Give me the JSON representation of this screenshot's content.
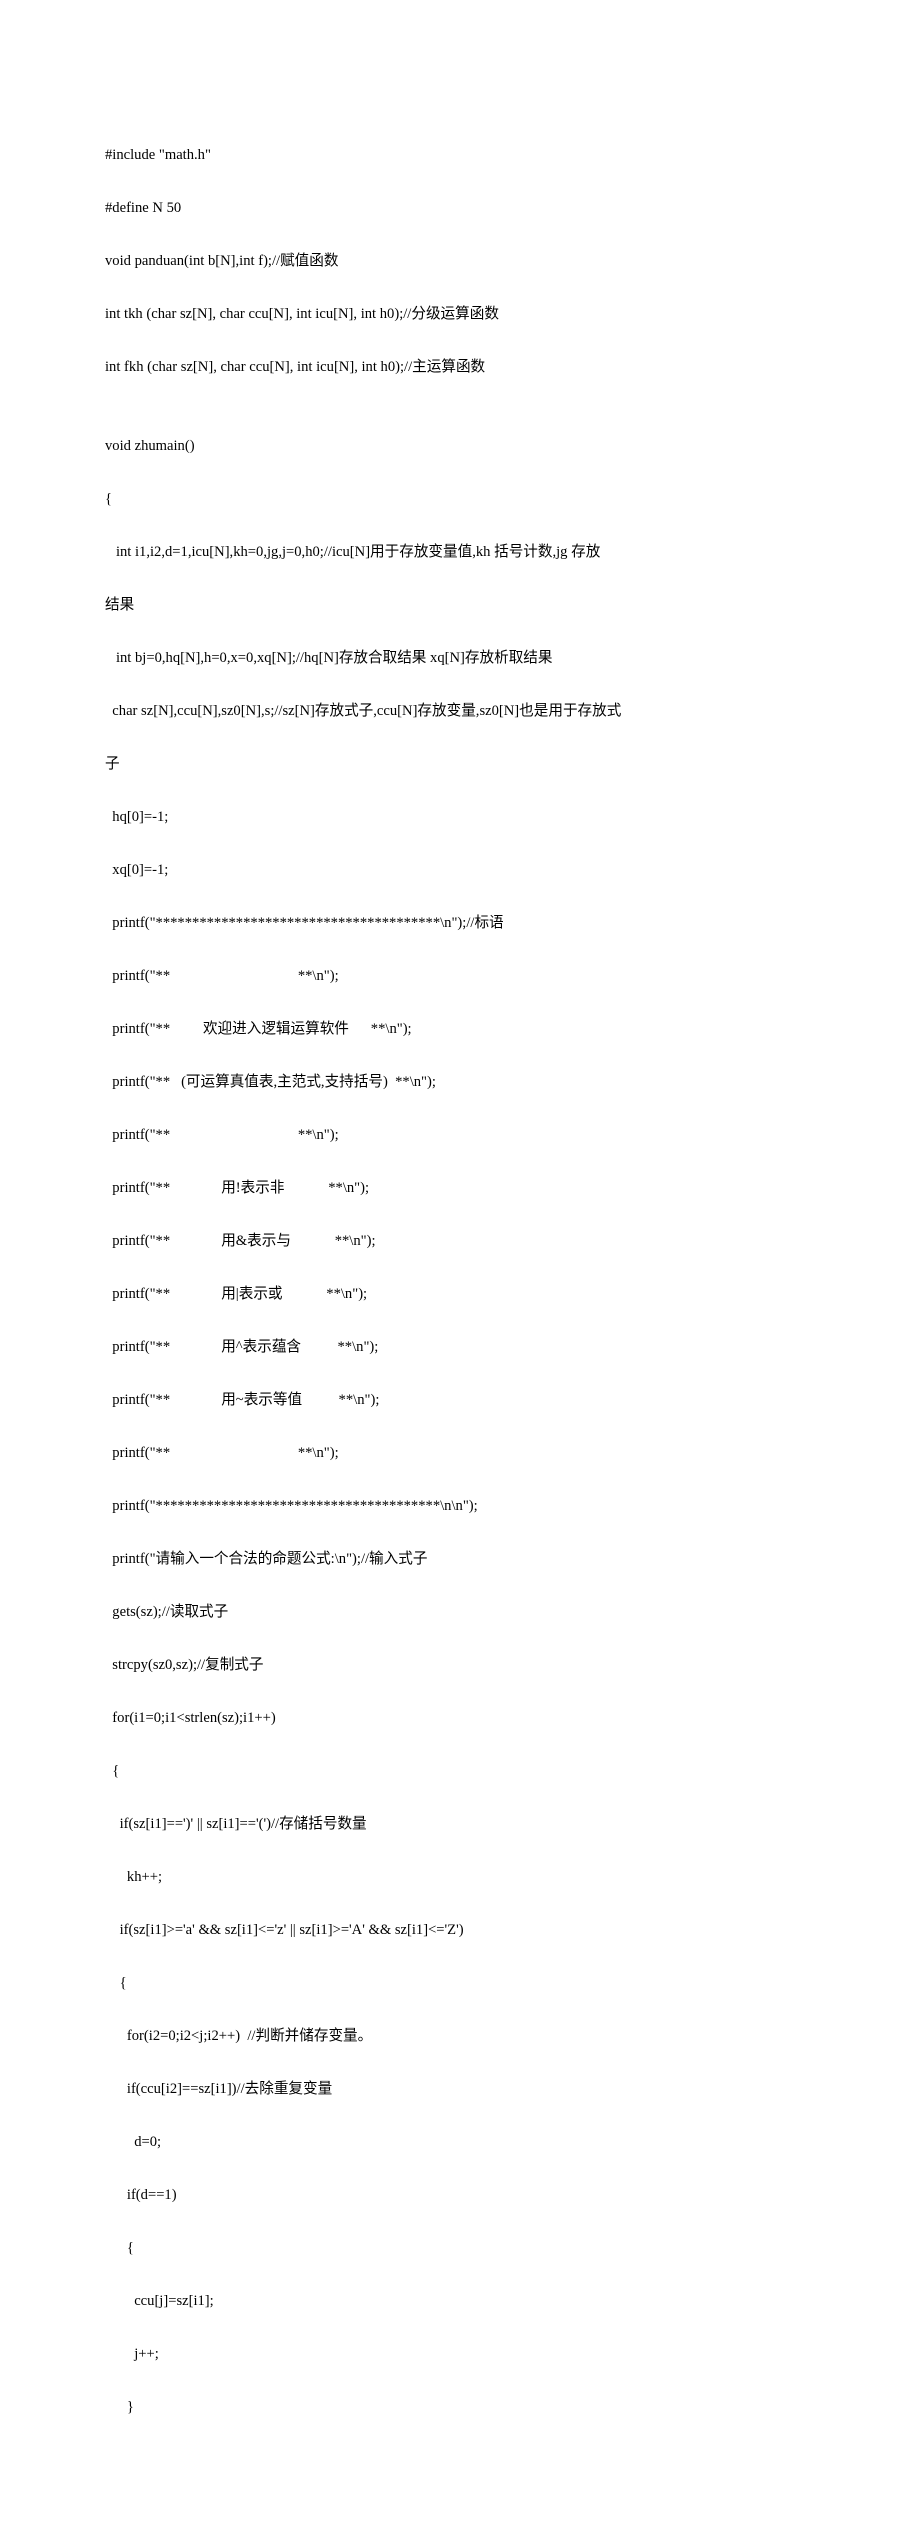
{
  "code": {
    "lines": [
      "#include \"math.h\"",
      "#define N 50",
      "void panduan(int b[N],int f);//赋值函数",
      "int tkh (char sz[N], char ccu[N], int icu[N], int h0);//分级运算函数",
      "int fkh (char sz[N], char ccu[N], int icu[N], int h0);//主运算函数",
      "",
      "void zhumain()",
      "{",
      "   int i1,i2,d=1,icu[N],kh=0,jg,j=0,h0;//icu[N]用于存放变量值,kh 括号计数,jg 存放",
      "结果",
      "   int bj=0,hq[N],h=0,x=0,xq[N];//hq[N]存放合取结果 xq[N]存放析取结果",
      "  char sz[N],ccu[N],sz0[N],s;//sz[N]存放式子,ccu[N]存放变量,sz0[N]也是用于存放式",
      "子",
      "  hq[0]=-1;",
      "  xq[0]=-1;",
      "  printf(\"***************************************\\n\");//标语",
      "  printf(\"**                                   **\\n\");",
      "  printf(\"**         欢迎进入逻辑运算软件      **\\n\");",
      "  printf(\"**   (可运算真值表,主范式,支持括号)  **\\n\");",
      "  printf(\"**                                   **\\n\");",
      "  printf(\"**              用!表示非            **\\n\");",
      "  printf(\"**              用&表示与            **\\n\");",
      "  printf(\"**              用|表示或            **\\n\");",
      "  printf(\"**              用^表示蕴含          **\\n\");",
      "  printf(\"**              用~表示等值          **\\n\");",
      "  printf(\"**                                   **\\n\");",
      "  printf(\"***************************************\\n\\n\");",
      "  printf(\"请输入一个合法的命题公式:\\n\");//输入式子",
      "  gets(sz);//读取式子",
      "  strcpy(sz0,sz);//复制式子",
      "  for(i1=0;i1<strlen(sz);i1++)",
      "  {",
      "    if(sz[i1]==')' || sz[i1]=='(')//存储括号数量",
      "      kh++;",
      "    if(sz[i1]>='a' && sz[i1]<='z' || sz[i1]>='A' && sz[i1]<='Z')",
      "    {",
      "      for(i2=0;i2<j;i2++)  //判断并储存变量。",
      "      if(ccu[i2]==sz[i1])//去除重复变量",
      "        d=0;",
      "      if(d==1)",
      "      {",
      "        ccu[j]=sz[i1];",
      "        j++;",
      "      }"
    ]
  }
}
